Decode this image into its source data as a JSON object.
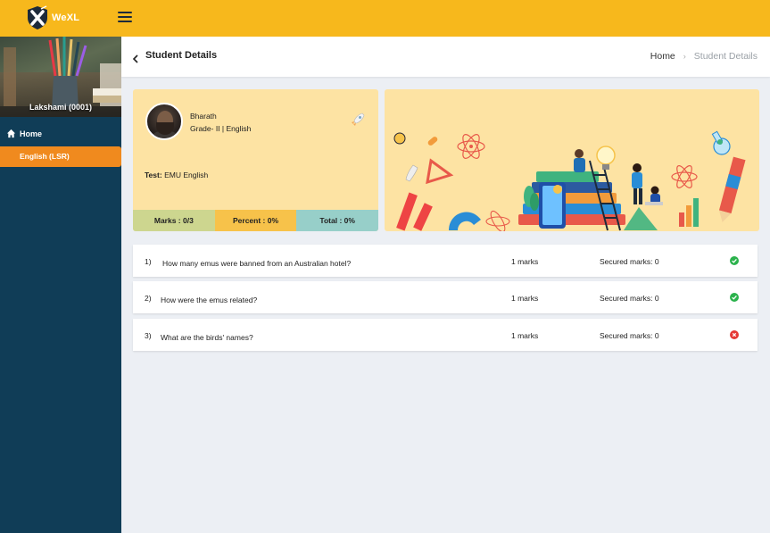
{
  "app": {
    "logo_text": "WeXL"
  },
  "sidebar": {
    "profile_name": "Lakshami (0001)",
    "home_label": "Home",
    "active_item_label": "English (LSR)"
  },
  "header": {
    "title": "Student Details",
    "breadcrumb_home": "Home",
    "breadcrumb_current": "Student Details"
  },
  "student": {
    "name": "Bharath",
    "grade": "Grade- II | English",
    "test_label": "Test:",
    "test_name": "EMU English",
    "marks": "Marks : 0/3",
    "percent": "Percent : 0%",
    "total": "Total : 0%"
  },
  "questions": [
    {
      "num": "1)",
      "text": "How many emus were banned from an Australian hotel?",
      "marks": "1 marks",
      "secured": "Secured marks: 0",
      "status": "correct"
    },
    {
      "num": "2)",
      "text": "How were the emus related?",
      "marks": "1 marks",
      "secured": "Secured marks: 0",
      "status": "correct"
    },
    {
      "num": "3)",
      "text": "What are the birds' names?",
      "marks": "1 marks",
      "secured": "Secured marks: 0",
      "status": "wrong"
    }
  ],
  "colors": {
    "topbar": "#f7b81c",
    "sidebar": "#103d57",
    "active_nav": "#f08a1e",
    "card_bg": "#fde3a3",
    "correct": "#2bb24c",
    "wrong": "#e53935"
  }
}
